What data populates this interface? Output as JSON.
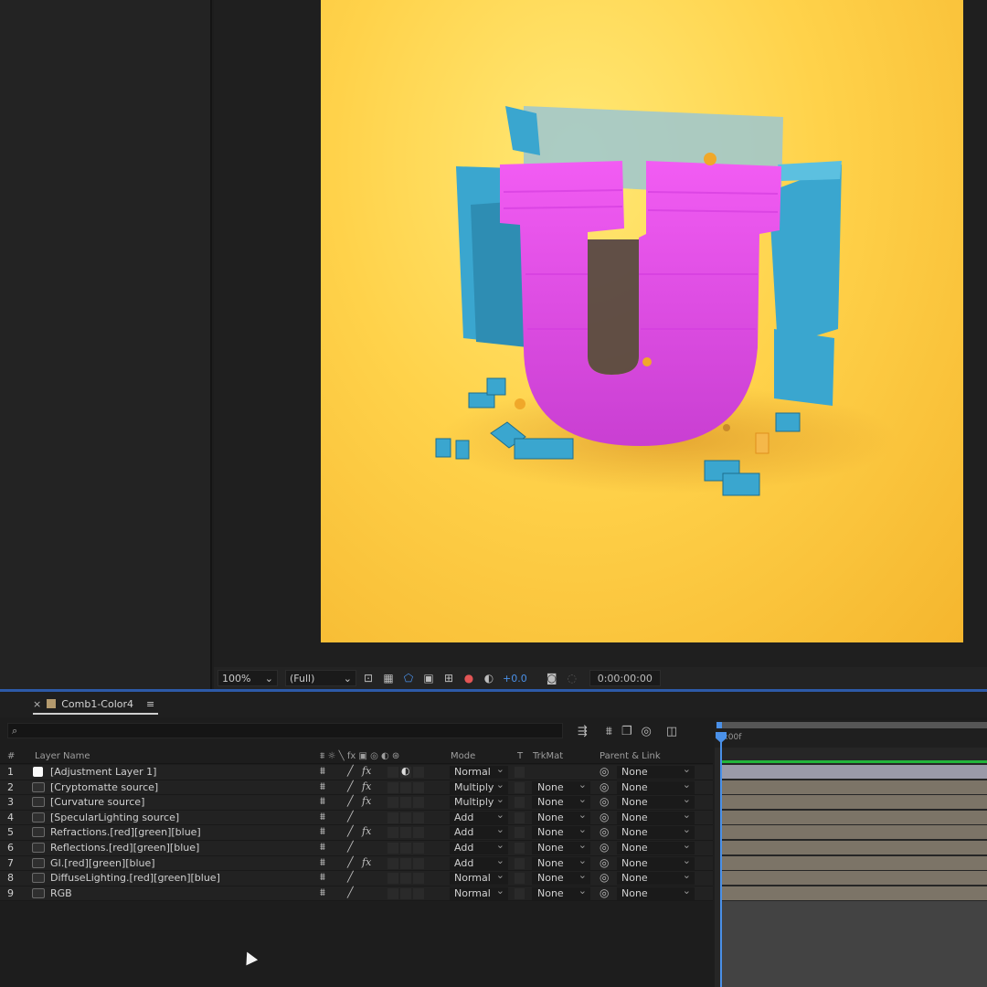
{
  "viewer": {
    "zoom": "100%",
    "resolution": "(Full)",
    "exposure": "+0.0",
    "timecode": "0:00:00:00",
    "composition_preview": "3d-letter-u-render"
  },
  "tab": {
    "comp_name": "Comb1-Color4",
    "close_glyph": "×",
    "menu_glyph": "≡"
  },
  "search": {
    "icon": "⌕"
  },
  "timeline": {
    "ruler_label": "0:00f"
  },
  "columns": {
    "num": "#",
    "layer_name": "Layer Name",
    "mode": "Mode",
    "t": "T",
    "trkmat": "TrkMat",
    "parent": "Parent & Link"
  },
  "glyphs": {
    "shy": "⩩",
    "slash": "╱",
    "fx": "fx",
    "pick": "◎"
  },
  "layers": [
    {
      "num": "1",
      "name": "[Adjustment Layer 1]",
      "mode": "Normal",
      "trkmat": "",
      "parent": "None",
      "fx": true,
      "adjust": true
    },
    {
      "num": "2",
      "name": "[Cryptomatte source]",
      "mode": "Multiply",
      "trkmat": "None",
      "parent": "None",
      "fx": true
    },
    {
      "num": "3",
      "name": "[Curvature source]",
      "mode": "Multiply",
      "trkmat": "None",
      "parent": "None",
      "fx": true
    },
    {
      "num": "4",
      "name": "[SpecularLighting source]",
      "mode": "Add",
      "trkmat": "None",
      "parent": "None",
      "fx": false
    },
    {
      "num": "5",
      "name": "Refractions.[red][green][blue]",
      "mode": "Add",
      "trkmat": "None",
      "parent": "None",
      "fx": true
    },
    {
      "num": "6",
      "name": "Reflections.[red][green][blue]",
      "mode": "Add",
      "trkmat": "None",
      "parent": "None",
      "fx": false
    },
    {
      "num": "7",
      "name": "GI.[red][green][blue]",
      "mode": "Add",
      "trkmat": "None",
      "parent": "None",
      "fx": true
    },
    {
      "num": "8",
      "name": "DiffuseLighting.[red][green][blue]",
      "mode": "Normal",
      "trkmat": "None",
      "parent": "None",
      "fx": false
    },
    {
      "num": "9",
      "name": "RGB",
      "mode": "Normal",
      "trkmat": "None",
      "parent": "None",
      "fx": false
    }
  ],
  "colors": {
    "accent": "#4a90e8",
    "green_bar": "#21b53b",
    "layer_bar": "#7c7467",
    "adjustment_bar": "#9a9aa8",
    "comp_bg": "#ffd24a",
    "letter": "#e34ce8",
    "blocks": "#3aa6cf"
  }
}
